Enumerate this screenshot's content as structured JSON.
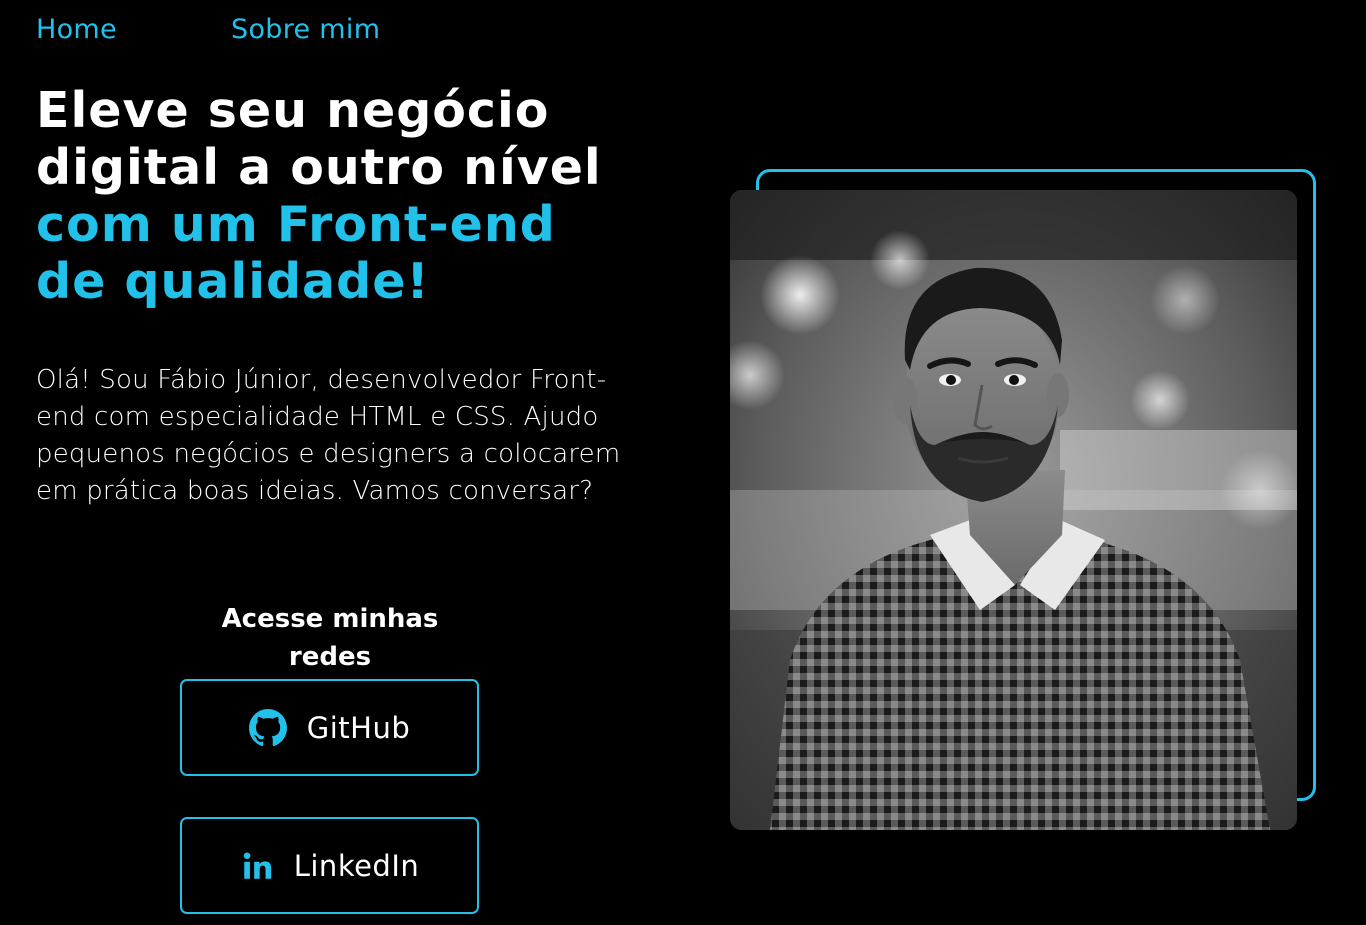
{
  "nav": {
    "home": "Home",
    "about": "Sobre mim"
  },
  "hero": {
    "title_line1": "Eleve seu negócio",
    "title_line2": "digital a outro nível",
    "title_line3": "com um Front-end",
    "title_line4": "de qualidade!",
    "intro": "Olá! Sou Fábio Júnior, desenvolvedor Front-end com especialidade HTML e CSS. Ajudo pequenos negócios e designers a colocarem em prática boas ideias. Vamos conversar?"
  },
  "social": {
    "title": "Acesse minhas redes",
    "github_label": "GitHub",
    "github_icon": "github-icon",
    "linkedin_label": "LinkedIn",
    "linkedin_icon": "linkedin-icon"
  },
  "photo": {
    "alt": "Foto de Fábio Júnior",
    "style": "black-and-white portrait"
  },
  "colors": {
    "background": "#000000",
    "accent": "#22c1ea",
    "text": "#ffffff"
  }
}
